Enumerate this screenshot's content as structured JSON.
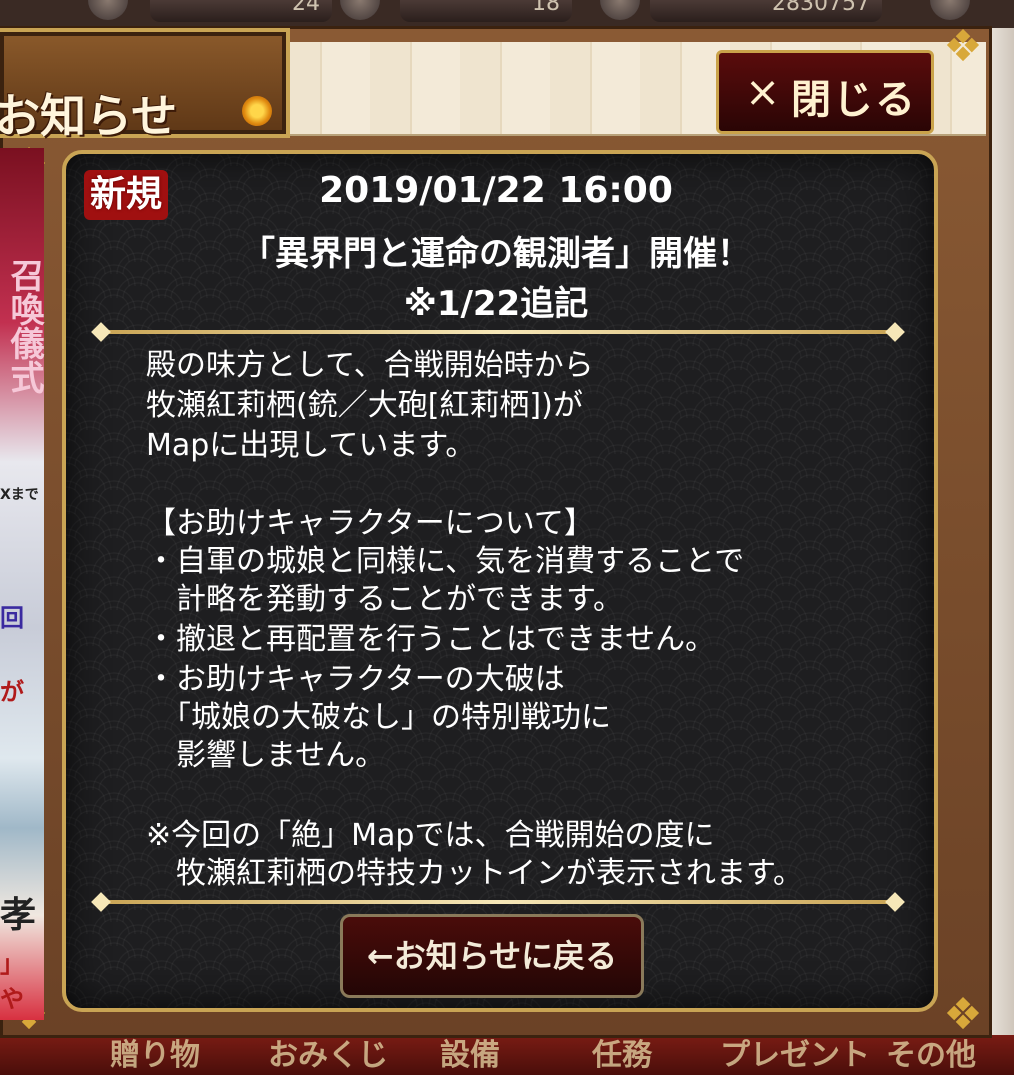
{
  "topbar": {
    "values": [
      "24",
      "18",
      "2830757"
    ]
  },
  "header": {
    "title": "お知らせ",
    "close_label": "閉じる",
    "close_icon": "×"
  },
  "left_strip": {
    "labels": [
      "召喚儀式",
      "Xまで",
      "回",
      "が",
      "孝",
      "」や"
    ]
  },
  "notice": {
    "badge": "新規",
    "datetime": "2019/01/22  16:00",
    "title": "「異界門と運命の観測者」開催！",
    "subtitle": "※1/22追記",
    "body_lines": [
      "殿の味方として、合戦開始時から",
      "牧瀬紅莉栖(銃／大砲[紅莉栖])が",
      "Mapに出現しています。",
      "",
      "【お助けキャラクターについて】",
      "・自軍の城娘と同様に、気を消費することで",
      "　計略を発動することができます。",
      "・撤退と再配置を行うことはできません。",
      "・お助けキャラクターの大破は",
      "　「城娘の大破なし」の特別戦功に",
      "　影響しません。",
      "",
      "※今回の「絶」Mapでは、合戦開始の度に",
      "　牧瀬紅莉栖の特技カットインが表示されます。"
    ],
    "back_label": "←お知らせに戻る"
  },
  "bottom_menu": {
    "items": [
      "贈り物",
      "おみくじ",
      "設備",
      "任務",
      "プレゼント",
      "その他"
    ]
  },
  "colors": {
    "gold": "#c9a454",
    "panel": "#1e1e20",
    "badge": "#a01010",
    "button": "#4a0c0a"
  }
}
